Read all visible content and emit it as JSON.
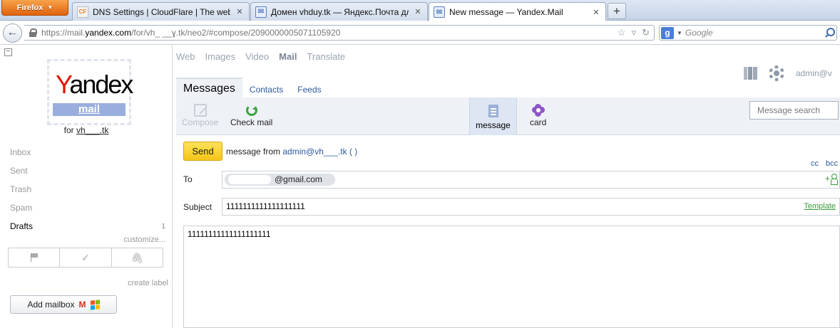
{
  "browser": {
    "menu_button": "Firefox",
    "tabs": [
      {
        "title": "DNS Settings | CloudFlare | The web p...",
        "favicon": "CF"
      },
      {
        "title": "Домен vhduy.tk — Яндекс.Почта дл...",
        "favicon": "✉"
      },
      {
        "title": "New message — Yandex.Mail",
        "favicon": "✉"
      }
    ],
    "new_tab": "+",
    "url_prefix": "https://mail.",
    "url_host": "yandex.com",
    "url_path": "/for/vh_ __ɣ.tk/neo2/#compose/2090000005071105920",
    "search_engine": "g",
    "search_placeholder": "Google"
  },
  "services": {
    "items": [
      "Web",
      "Images",
      "Video",
      "Mail",
      "Translate"
    ],
    "current": "Mail"
  },
  "account": {
    "user": "admin@v"
  },
  "logo": {
    "first_letter": "Y",
    "rest": "andex",
    "sub": "mail",
    "for_label": "for",
    "domain": "vh___.tk"
  },
  "folders": {
    "inbox": "Inbox",
    "sent": "Sent",
    "trash": "Trash",
    "spam": "Spam",
    "drafts": "Drafts",
    "drafts_count": "1",
    "customize": "customize...",
    "create_label": "create label",
    "add_mailbox": "Add mailbox"
  },
  "tabs": {
    "messages": "Messages",
    "contacts": "Contacts",
    "feeds": "Feeds"
  },
  "toolbar": {
    "compose": "Compose",
    "check_mail": "Check mail",
    "message": "message",
    "card": "card",
    "search_placeholder": "Message search"
  },
  "compose": {
    "send": "Send",
    "from_prefix": "message from",
    "from_address": "admin@vh___.tk ( )",
    "cc": "cc",
    "bcc": "bcc",
    "to_label": "To",
    "to_value": "@gmail.com",
    "add_contact": "+",
    "subject_label": "Subject",
    "subject_value": "1111111111111111111",
    "template": "Template",
    "body_value": "11111111111111111111"
  }
}
